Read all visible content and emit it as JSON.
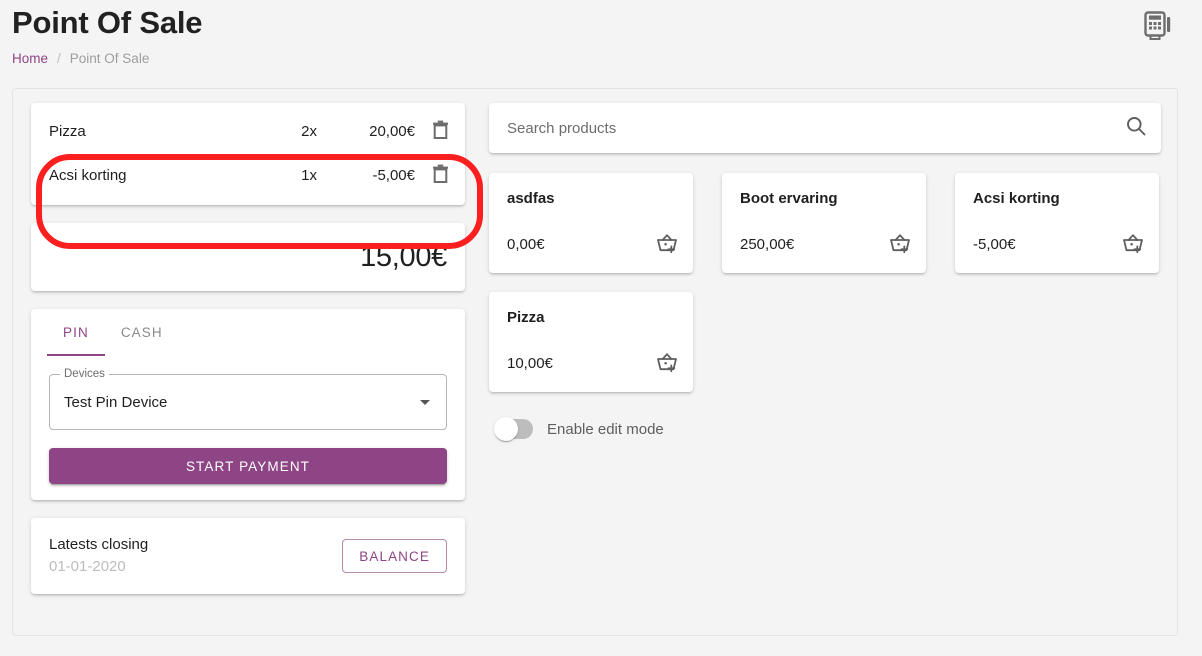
{
  "header": {
    "title": "Point Of Sale",
    "breadcrumb": {
      "home": "Home",
      "separator": "/",
      "current": "Point Of Sale"
    },
    "terminal_icon": "pin-terminal-icon"
  },
  "cart": {
    "items": [
      {
        "name": "Pizza",
        "qty": "2x",
        "price": "20,00€",
        "delete_icon": "trash-icon"
      },
      {
        "name": "Acsi korting",
        "qty": "1x",
        "price": "-5,00€",
        "delete_icon": "trash-icon"
      }
    ]
  },
  "total": {
    "amount": "15,00€"
  },
  "payment": {
    "tabs": [
      {
        "label": "PIN",
        "active": true
      },
      {
        "label": "CASH",
        "active": false
      }
    ],
    "device_field": {
      "legend": "Devices",
      "value": "Test Pin Device",
      "caret_icon": "chevron-down-icon"
    },
    "start_button": "START PAYMENT"
  },
  "closing": {
    "title": "Latests closing",
    "date": "01-01-2020",
    "balance_button": "BALANCE"
  },
  "search": {
    "placeholder": "Search products",
    "value": "",
    "icon": "search-icon"
  },
  "products": [
    {
      "name": "asdfas",
      "price": "0,00€",
      "add_icon": "add-to-basket-icon"
    },
    {
      "name": "Boot ervaring",
      "price": "250,00€",
      "add_icon": "add-to-basket-icon"
    },
    {
      "name": "Acsi korting",
      "price": "-5,00€",
      "add_icon": "add-to-basket-icon"
    },
    {
      "name": "Pizza",
      "price": "10,00€",
      "add_icon": "add-to-basket-icon"
    }
  ],
  "edit_mode": {
    "label": "Enable edit mode",
    "enabled": false
  },
  "colors": {
    "accent": "#8e4585",
    "annotation": "#fc1f1f",
    "page_background": "#f4f4f4",
    "card_background": "#ffffff"
  }
}
